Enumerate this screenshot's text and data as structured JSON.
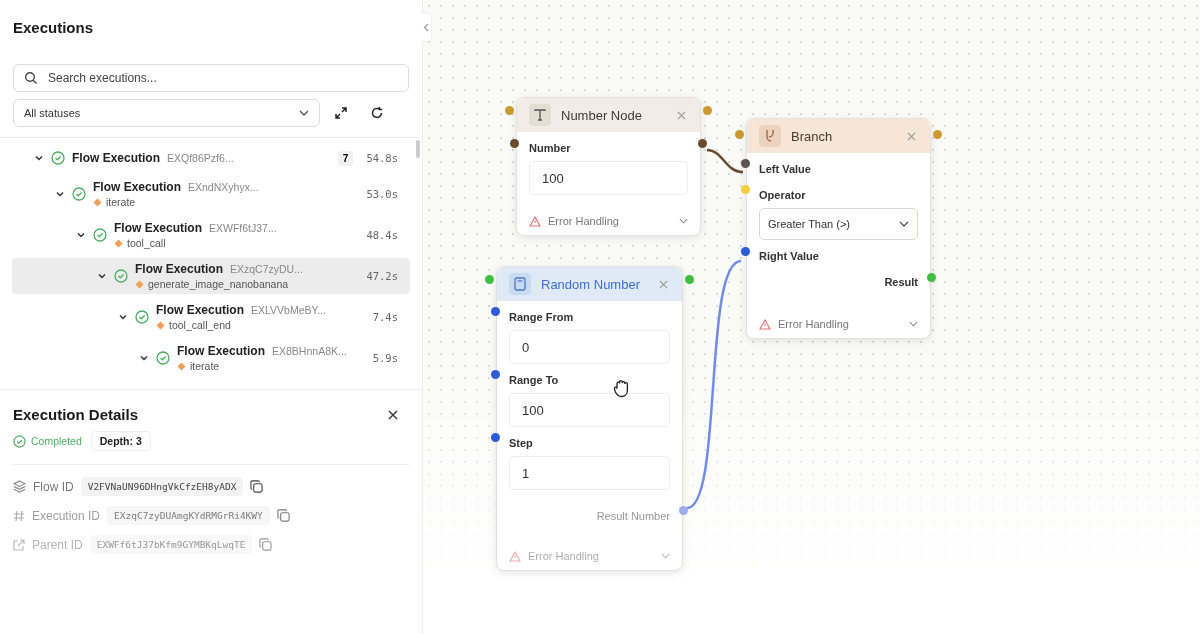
{
  "sidebar": {
    "title": "Executions",
    "search": {
      "placeholder": "Search executions..."
    },
    "status_filter": {
      "value": "All statuses"
    },
    "tree": [
      {
        "title": "Flow Execution",
        "id": "EXQf86Pzf6...",
        "count": "7",
        "duration": "54.8s",
        "expanded": true,
        "selected": false,
        "children": [
          {
            "title": "Flow Execution",
            "id": "EXndNXyhyx...",
            "tag": "iterate",
            "duration": "53.0s",
            "expanded": true,
            "selected": false,
            "children": [
              {
                "title": "Flow Execution",
                "id": "EXWFf6tJ37...",
                "tag": "tool_call",
                "duration": "48.4s",
                "expanded": true,
                "selected": false,
                "children": [
                  {
                    "title": "Flow Execution",
                    "id": "EXzqC7zyDU...",
                    "tag": "generate_image_nanobanana",
                    "duration": "47.2s",
                    "expanded": true,
                    "selected": true,
                    "children": [
                      {
                        "title": "Flow Execution",
                        "id": "EXLVVbMeBY...",
                        "tag": "tool_call_end",
                        "duration": "7.4s",
                        "expanded": true,
                        "selected": false,
                        "children": [
                          {
                            "title": "Flow Execution",
                            "id": "EX8BHnnA8K...",
                            "tag": "iterate",
                            "duration": "5.9s",
                            "expanded": true,
                            "selected": false
                          }
                        ]
                      }
                    ]
                  }
                ]
              }
            ]
          }
        ]
      }
    ]
  },
  "details": {
    "title": "Execution Details",
    "status": "Completed",
    "depth": "Depth: 3",
    "rows": [
      {
        "kind": "flow",
        "label": "Flow ID",
        "value": "V2FVNaUN96DHngVkCfzEH8yADX"
      },
      {
        "kind": "execution",
        "label": "Execution ID",
        "value": "EXzqC7zyDUAmgKYdRMGrRi4KWY"
      },
      {
        "kind": "parent",
        "label": "Parent ID",
        "value": "EXWFf6tJ37bKfm9GYMBKqLwqTE"
      }
    ]
  },
  "canvas": {
    "nodes": [
      {
        "kind": "number",
        "title": "Number Node",
        "fields": [
          {
            "kind": "input",
            "label": "Number",
            "value": "100"
          }
        ],
        "error": "Error Handling"
      },
      {
        "kind": "branch",
        "title": "Branch",
        "fields": [
          {
            "kind": "port",
            "label": "Left Value"
          },
          {
            "kind": "select",
            "label": "Operator",
            "value": "Greater Than (>)"
          },
          {
            "kind": "port",
            "label": "Right Value"
          }
        ],
        "output": "Result",
        "error": "Error Handling"
      },
      {
        "kind": "random",
        "title": "Random Number",
        "fields": [
          {
            "kind": "input",
            "label": "Range From",
            "value": "0"
          },
          {
            "kind": "input",
            "label": "Range To",
            "value": "100"
          },
          {
            "kind": "input",
            "label": "Step",
            "value": "1"
          }
        ],
        "output": "Result Number",
        "error": "Error Handling"
      }
    ]
  }
}
